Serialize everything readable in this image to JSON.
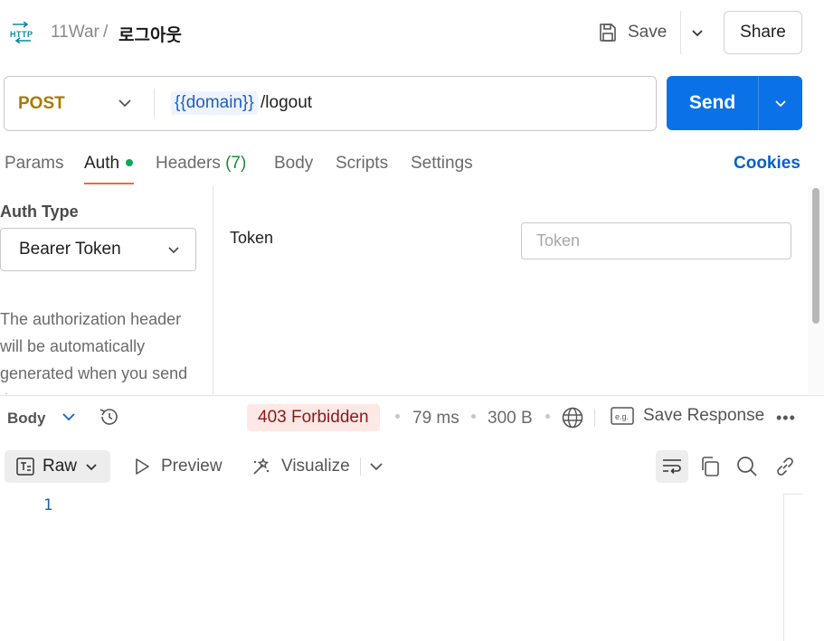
{
  "breadcrumb": {
    "collection": "11War",
    "separator": "/",
    "request": "로그아웃"
  },
  "header": {
    "save_label": "Save",
    "share_label": "Share"
  },
  "request": {
    "method": "POST",
    "url_variable": "{{domain}}",
    "url_path": "/logout",
    "send_label": "Send"
  },
  "tabs": {
    "params": "Params",
    "auth": "Auth",
    "headers": "Headers",
    "headers_count": "(7)",
    "body": "Body",
    "scripts": "Scripts",
    "settings": "Settings",
    "cookies": "Cookies"
  },
  "auth": {
    "type_label": "Auth Type",
    "type_value": "Bearer Token",
    "description": "The authorization header will be automatically generated when you send the request.",
    "token_label": "Token",
    "token_placeholder": "Token"
  },
  "response": {
    "body_label": "Body",
    "status": "403 Forbidden",
    "time": "79 ms",
    "size": "300 B",
    "save_response": "Save Response",
    "formats": {
      "raw": "Raw",
      "preview": "Preview",
      "visualize": "Visualize"
    },
    "line_number": "1"
  },
  "colors": {
    "accent": "#0a72e6",
    "method": "#a87a00",
    "status_bg": "#fde8e6",
    "status_fg": "#8b1a1a",
    "tab_underline": "#f26b3a"
  }
}
